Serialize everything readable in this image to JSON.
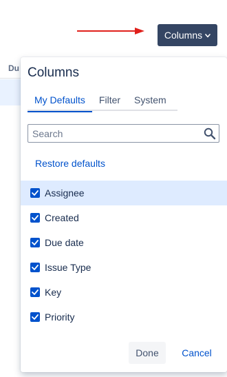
{
  "background": {
    "column_header_fragment": "Du"
  },
  "annotation": {
    "arrow_color": "#e0201b"
  },
  "columns_button": {
    "label": "Columns",
    "icon": "chevron-down-icon",
    "bg_color": "#344563"
  },
  "panel": {
    "title": "Columns",
    "tabs": [
      {
        "label": "My Defaults",
        "active": true
      },
      {
        "label": "Filter",
        "active": false
      },
      {
        "label": "System",
        "active": false
      }
    ],
    "search": {
      "value": "",
      "placeholder": "Search",
      "icon": "search-icon"
    },
    "restore_label": "Restore defaults",
    "options": [
      {
        "label": "Assignee",
        "checked": true
      },
      {
        "label": "Created",
        "checked": true
      },
      {
        "label": "Due date",
        "checked": true
      },
      {
        "label": "Issue Type",
        "checked": true
      },
      {
        "label": "Key",
        "checked": true
      },
      {
        "label": "Priority",
        "checked": true
      }
    ],
    "done_label": "Done",
    "cancel_label": "Cancel"
  },
  "colors": {
    "accent": "#0052cc",
    "hover_row": "#deebff",
    "text": "#172b4d"
  }
}
